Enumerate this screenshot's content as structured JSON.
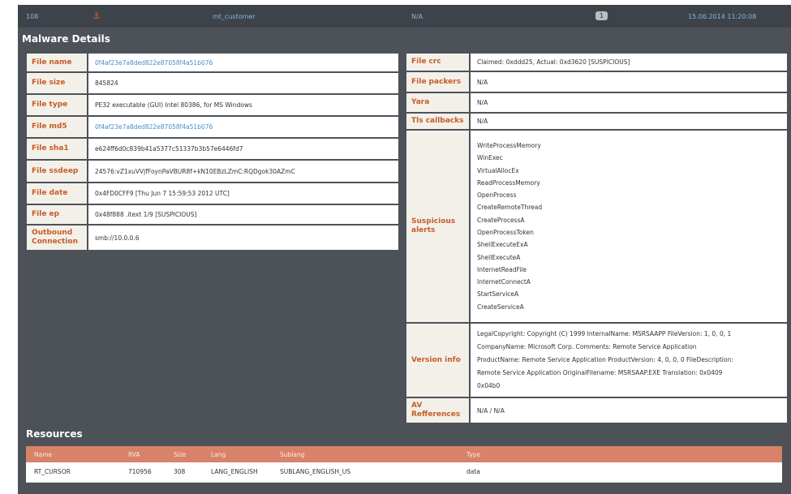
{
  "topbar": {
    "id": "108",
    "icon": "bug-icon",
    "user": "mt_customer",
    "status": "N/A",
    "count": "1",
    "datetime": "15.06.2014 11:20:08"
  },
  "malware": {
    "title": "Malware Details",
    "left": [
      {
        "label": "File name",
        "value": "0f4af23e7a8ded822e87058f4a51b076"
      },
      {
        "label": "File size",
        "value": "845824"
      },
      {
        "label": "File type",
        "value": "PE32 executable (GUI) Intel 80386, for MS Windows"
      },
      {
        "label": "File md5",
        "value": "0f4af23e7a8ded822e87058f4a51b076"
      },
      {
        "label": "File sha1",
        "value": "e624ff6d0c839b41a5377c51337b3b57e6446fd7"
      },
      {
        "label": "File ssdeep",
        "value": "24576:vZ1xuVVjfFoynPaVBUR8f+kN10EBzLZmC:RQDgok30AZmC"
      },
      {
        "label": "File date",
        "value": "0x4FD0CFF9 [Thu Jun 7 15:59:53 2012 UTC]"
      },
      {
        "label": "File ep",
        "value": "0x48f888 .itext 1/9 [SUSPICIOUS]"
      },
      {
        "label": "Outbound Connection",
        "value": "smb://10.0.0.6"
      }
    ],
    "right": {
      "crc": {
        "label": "File crc",
        "value": "Claimed: 0xddd25, Actual: 0xd3620 [SUSPICIOUS]"
      },
      "packers": {
        "label": "File packers",
        "value": "N/A"
      },
      "yara": {
        "label": "Yara",
        "value": "N/A"
      },
      "tls": {
        "label": "Tls callbacks",
        "value": "N/A"
      },
      "alerts_label": "Suspicious alerts",
      "alerts": [
        "WriteProcessMemory",
        "WinExec",
        "VirtualAllocEx",
        "ReadProcessMemory",
        "OpenProcess",
        "CreateRemoteThread",
        "CreateProcessA",
        "OpenProcessToken",
        "ShellExecuteExA",
        "ShellExecuteA",
        "InternetReadFile",
        "InternetConnectA",
        "StartServiceA",
        "CreateServiceA"
      ],
      "version_label": "Version info",
      "version_lines": [
        "LegalCopyright: Copyright (C) 1999 InternalName: MSRSAAPP FileVersion: 1, 0, 0, 1",
        "CompanyName: Microsoft Corp. Comments: Remote Service Application",
        "ProductName: Remote Service Application ProductVersion: 4, 0, 0, 0 FileDescription:",
        "Remote Service Application OriginalFilename: MSRSAAP.EXE Translation: 0x0409",
        "0x04b0"
      ],
      "av": {
        "label": "AV Refferences",
        "value": "N/A / N/A"
      }
    }
  },
  "resources": {
    "title": "Resources",
    "columns": [
      "Name",
      "RVA",
      "Size",
      "Lang",
      "Sublang",
      "Type"
    ],
    "rows": [
      [
        "RT_CURSOR",
        "710956",
        "308",
        "LANG_ENGLISH",
        "SUBLANG_ENGLISH_US",
        "data"
      ]
    ]
  },
  "colors": {
    "panel_bg": "#4d5259",
    "label": "#c65c24",
    "link": "#4a8cc8",
    "header_row": "#d8826a"
  }
}
